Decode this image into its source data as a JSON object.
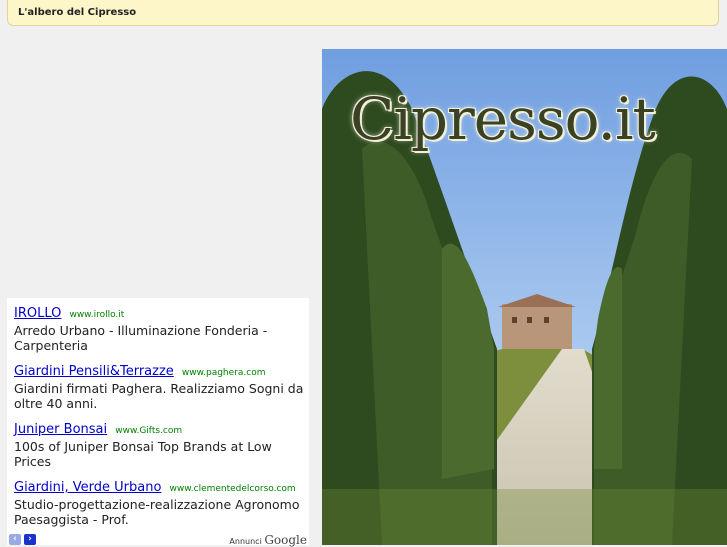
{
  "header": {
    "title": "L'albero del Cipresso"
  },
  "ads": [
    {
      "title": "IROLLO",
      "url": "www.irollo.it",
      "desc": "Arredo Urbano - Illuminazione Fonderia - Carpenteria"
    },
    {
      "title": "Giardini Pensili&Terrazze",
      "url": "www.paghera.com",
      "desc": "Giardini firmati Paghera. Realizziamo Sogni da oltre 40 anni."
    },
    {
      "title": "Juniper Bonsai",
      "url": "www.Gifts.com",
      "desc": "100s of Juniper Bonsai Top Brands at Low Prices"
    },
    {
      "title": "Giardini, Verde Urbano",
      "url": "www.clementedelcorso.com",
      "desc": "Studio-progettazione-realizzazione Agronomo Paesaggista - Prof."
    }
  ],
  "ad_footer": {
    "prev": "‹",
    "next": "›",
    "annunci": "Annunci",
    "google": "Google"
  },
  "hero": {
    "logo": "Cipresso.it"
  },
  "colors": {
    "title_bg": "#fdf6c9",
    "link": "#0000cc",
    "url": "#008000"
  }
}
